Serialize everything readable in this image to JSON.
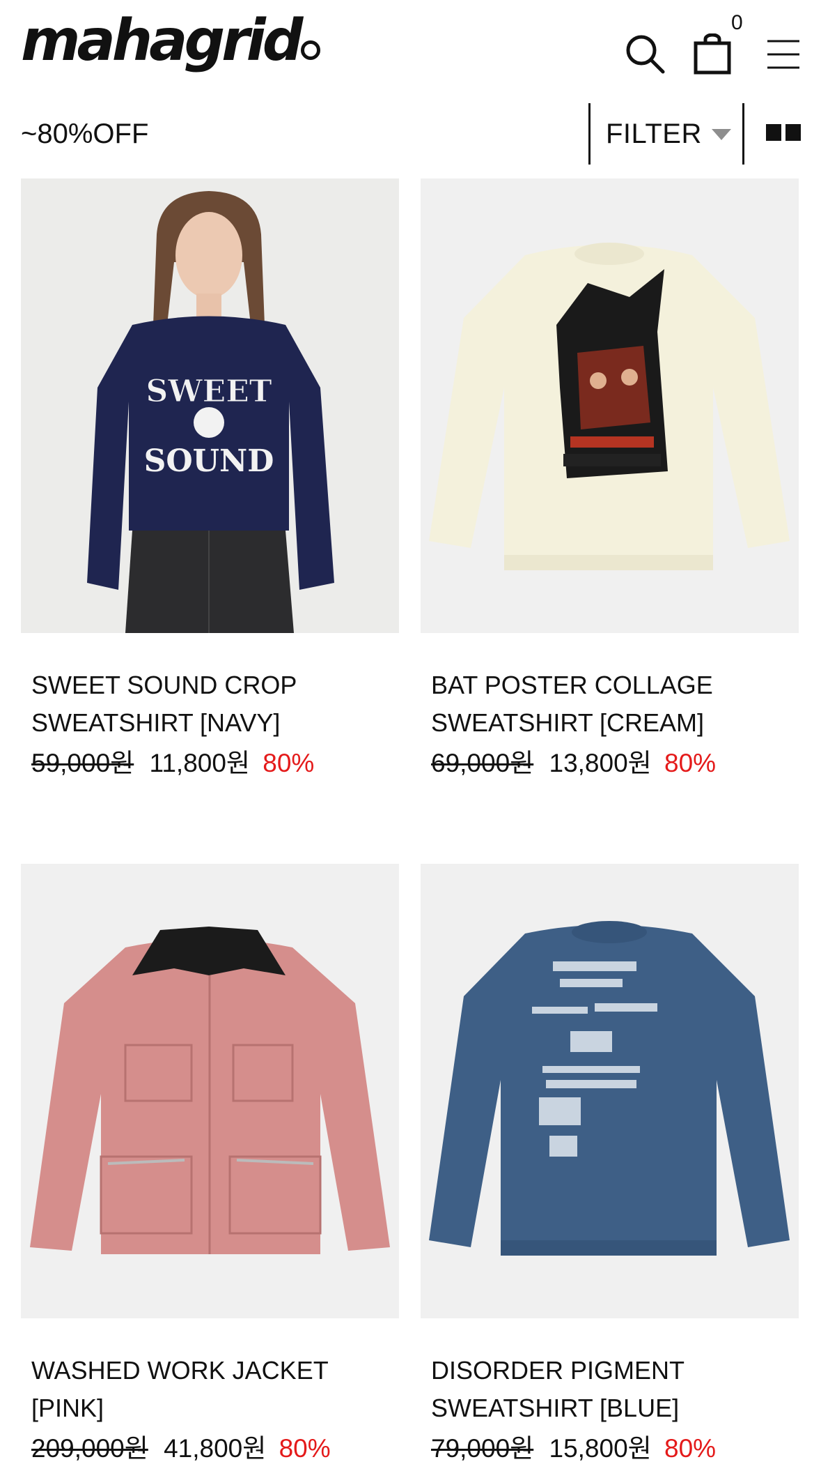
{
  "header": {
    "logo": "mahagrid",
    "cart_count": "0",
    "icons": [
      "search-icon",
      "shopping-bag-icon",
      "menu-icon"
    ]
  },
  "toolbar": {
    "promo_label": "~80%OFF",
    "filter_label": "FILTER"
  },
  "colors": {
    "accent_discount": "#e41a1a",
    "image_bg": "#f0f0f0"
  },
  "products": [
    {
      "name_line1": "SWEET SOUND CROP",
      "name_line2": "SWEATSHIRT [NAVY]",
      "original_price": "59,000원",
      "sale_price": "11,800원",
      "discount": "80%"
    },
    {
      "name_line1": "BAT POSTER COLLAGE",
      "name_line2": "SWEATSHIRT [CREAM]",
      "original_price": "69,000원",
      "sale_price": "13,800원",
      "discount": "80%"
    },
    {
      "name_line1": "WASHED WORK JACKET",
      "name_line2": "[PINK]",
      "original_price": "209,000원",
      "sale_price": "41,800원",
      "discount": "80%"
    },
    {
      "name_line1": "DISORDER PIGMENT",
      "name_line2": "SWEATSHIRT [BLUE]",
      "original_price": "79,000원",
      "sale_price": "15,800원",
      "discount": "80%"
    }
  ]
}
